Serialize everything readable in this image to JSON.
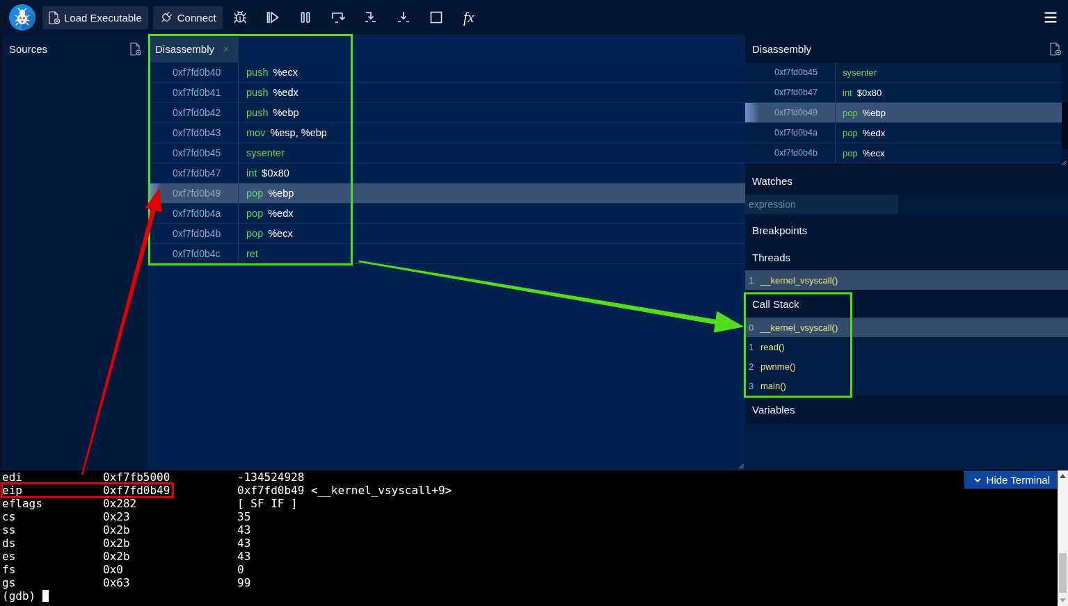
{
  "toolbar": {
    "load_button": "Load Executable",
    "connect_button": "Connect",
    "expression_button": "fx"
  },
  "sources_panel": {
    "title": "Sources"
  },
  "editor": {
    "tabs": [
      {
        "label": "Disassembly",
        "selected": true
      }
    ],
    "rows": [
      {
        "address": "0xf7fd0b40",
        "mnemonic": "push",
        "operands": "%ecx",
        "current": false
      },
      {
        "address": "0xf7fd0b41",
        "mnemonic": "push",
        "operands": "%edx",
        "current": false
      },
      {
        "address": "0xf7fd0b42",
        "mnemonic": "push",
        "operands": "%ebp",
        "current": false
      },
      {
        "address": "0xf7fd0b43",
        "mnemonic": "mov",
        "operands": "%esp, %ebp",
        "current": false
      },
      {
        "address": "0xf7fd0b45",
        "mnemonic": "sysenter",
        "current": false
      },
      {
        "address": "0xf7fd0b47",
        "mnemonic": "int",
        "operands": "$0x80",
        "current": false
      },
      {
        "address": "0xf7fd0b49",
        "mnemonic": "pop",
        "operands": "%ebp",
        "current": true
      },
      {
        "address": "0xf7fd0b4a",
        "mnemonic": "pop",
        "operands": "%edx",
        "current": false
      },
      {
        "address": "0xf7fd0b4b",
        "mnemonic": "pop",
        "operands": "%ecx",
        "current": false
      },
      {
        "address": "0xf7fd0b4c",
        "mnemonic": "ret",
        "current": false
      }
    ]
  },
  "side_panel": {
    "disassembly": {
      "title": "Disassembly",
      "rows": [
        {
          "address": "0xf7fd0b45",
          "mnemonic": "sysenter",
          "current": false
        },
        {
          "address": "0xf7fd0b47",
          "mnemonic": "int",
          "operands": "$0x80",
          "current": false
        },
        {
          "address": "0xf7fd0b49",
          "mnemonic": "pop",
          "operands": "%ebp",
          "current": true
        },
        {
          "address": "0xf7fd0b4a",
          "mnemonic": "pop",
          "operands": "%edx",
          "current": false
        },
        {
          "address": "0xf7fd0b4b",
          "mnemonic": "pop",
          "operands": "%ecx",
          "current": false
        }
      ]
    },
    "watches": {
      "title": "Watches",
      "placeholder": "expression"
    },
    "breakpoints": {
      "title": "Breakpoints"
    },
    "threads": {
      "title": "Threads",
      "items": [
        {
          "id": "1",
          "name": "__kernel_vsyscall()",
          "selected": true
        }
      ]
    },
    "call_stack": {
      "title": "Call Stack",
      "frames": [
        {
          "index": "0",
          "name": "__kernel_vsyscall()",
          "selected": true
        },
        {
          "index": "1",
          "name": "read()",
          "selected": false
        },
        {
          "index": "2",
          "name": "pwnme()",
          "selected": false
        },
        {
          "index": "3",
          "name": "main()",
          "selected": false
        }
      ]
    },
    "variables": {
      "title": "Variables"
    }
  },
  "terminal": {
    "registers": [
      {
        "name": "edi",
        "value": "0xf7fb5000",
        "natural": "-134524928"
      },
      {
        "name": "eip",
        "value": "0xf7fd0b49",
        "natural": "0xf7fd0b49 <__kernel_vsyscall+9>"
      },
      {
        "name": "eflags",
        "value": "0x282",
        "natural": "[ SF IF ]"
      },
      {
        "name": "cs",
        "value": "0x23",
        "natural": "35"
      },
      {
        "name": "ss",
        "value": "0x2b",
        "natural": "43"
      },
      {
        "name": "ds",
        "value": "0x2b",
        "natural": "43"
      },
      {
        "name": "es",
        "value": "0x2b",
        "natural": "43"
      },
      {
        "name": "fs",
        "value": "0x0",
        "natural": "0"
      },
      {
        "name": "gs",
        "value": "0x63",
        "natural": "99"
      }
    ],
    "prompt": "(gdb)",
    "hide_button": "Hide Terminal"
  },
  "annotations": [
    {
      "kind": "frame",
      "color": "#4fe01a"
    },
    {
      "kind": "arrow",
      "color": "#4fe01a"
    },
    {
      "kind": "frame",
      "color": "#4fe01a"
    },
    {
      "kind": "frame",
      "color": "#e00000"
    },
    {
      "kind": "arrow",
      "color": "#e00000"
    }
  ]
}
